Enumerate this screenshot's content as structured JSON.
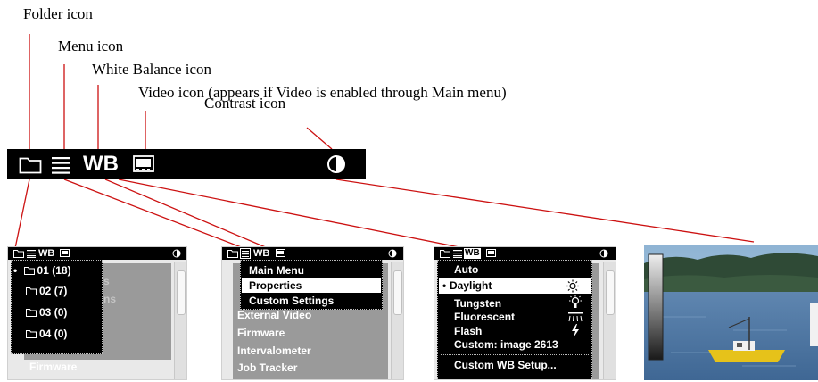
{
  "callouts": {
    "folder": "Folder icon",
    "menu": "Menu icon",
    "white_balance": "White Balance icon",
    "video": "Video icon (appears if Video is enabled through Main menu)",
    "contrast": "Contrast icon"
  },
  "toolbar": {
    "wb_label": "WB",
    "icons": [
      "folder-icon",
      "menu-icon",
      "white-balance-icon",
      "video-icon",
      "contrast-icon"
    ]
  },
  "folder_panel": {
    "folders": [
      {
        "label": "01",
        "count": "(18)",
        "selected": true
      },
      {
        "label": "02",
        "count": "(7)",
        "selected": false
      },
      {
        "label": "03",
        "count": "(0)",
        "selected": false
      },
      {
        "label": "04",
        "count": "(0)",
        "selected": false
      }
    ],
    "background_items": [
      "s",
      "ns",
      "Firmware"
    ]
  },
  "menu_panel": {
    "items": [
      "Main Menu",
      "Properties",
      "Custom Settings"
    ],
    "selected_index": 1,
    "background_items": [
      "External Video",
      "Firmware",
      "Intervalometer",
      "Job Tracker"
    ]
  },
  "wb_panel": {
    "options": [
      {
        "label": "Auto",
        "icon": "",
        "selected": false
      },
      {
        "label": "Daylight",
        "icon": "sun-icon",
        "selected": true
      },
      {
        "label": "Tungsten",
        "icon": "bulb-icon",
        "selected": false
      },
      {
        "label": "Fluorescent",
        "icon": "fluorescent-icon",
        "selected": false
      },
      {
        "label": "Flash",
        "icon": "flash-icon",
        "selected": false
      },
      {
        "label": "Custom: image 2613",
        "icon": "",
        "selected": false
      }
    ],
    "setup_label": "Custom WB Setup..."
  },
  "colors": {
    "callout_line": "#cc1111",
    "bar": "#000000",
    "panel_gray": "#9a9a9a"
  }
}
